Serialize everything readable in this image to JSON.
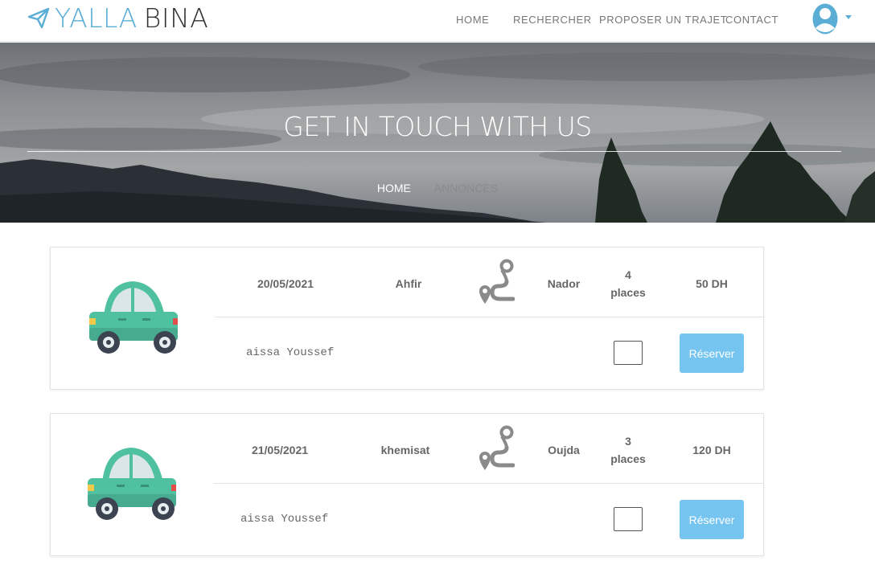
{
  "brand": {
    "part1": "YALLA",
    "part2": "BINA"
  },
  "nav": {
    "items": [
      {
        "label": "HOME"
      },
      {
        "label": "RECHERCHER"
      },
      {
        "label": "PROPOSER UN TRAJET"
      },
      {
        "label": "CONTACT"
      }
    ]
  },
  "hero": {
    "title": "GET IN TOUCH WITH US",
    "breadcrumb": {
      "home": "HOME",
      "separator": "/",
      "current": "ANNONCES"
    }
  },
  "listings": [
    {
      "date": "20/05/2021",
      "from": "Ahfir",
      "to": "Nador",
      "seats_count": "4",
      "seats_label": "places",
      "price": "50 DH",
      "driver": "aissa Youssef",
      "button_label": "Réserver"
    },
    {
      "date": "21/05/2021",
      "from": "khemisat",
      "to": "Oujda",
      "seats_count": "3",
      "seats_label": "places",
      "price": "120 DH",
      "driver": "aissa Youssef",
      "button_label": "Réserver"
    }
  ],
  "colors": {
    "brand_blue": "#5aaed6",
    "button_blue": "#76c4f0",
    "car_teal": "#4fc1a0"
  },
  "icons": [
    "paper-plane-icon",
    "user-avatar-icon",
    "caret-down-icon",
    "car-icon",
    "route-icon"
  ]
}
